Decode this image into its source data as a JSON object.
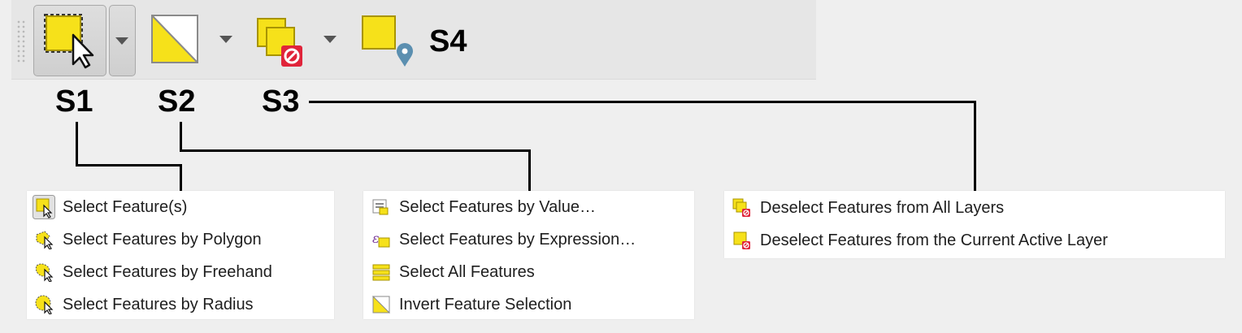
{
  "toolbar": {
    "s4_label": "S4",
    "buttons": [
      {
        "icon": "select-features-icon"
      },
      {
        "icon": "select-features-by-value-icon"
      },
      {
        "icon": "deselect-features-icon"
      },
      {
        "icon": "select-by-location-icon"
      }
    ]
  },
  "labels": {
    "s1": "S1",
    "s2": "S2",
    "s3": "S3"
  },
  "menus": {
    "s1": {
      "items": [
        {
          "label": "Select Feature(s)",
          "icon": "select-feature-icon"
        },
        {
          "label": "Select Features by Polygon",
          "icon": "select-polygon-icon"
        },
        {
          "label": "Select Features by Freehand",
          "icon": "select-freehand-icon"
        },
        {
          "label": "Select Features by Radius",
          "icon": "select-radius-icon"
        }
      ]
    },
    "s2": {
      "items": [
        {
          "label": "Select Features by Value…",
          "icon": "select-by-value-icon"
        },
        {
          "label": "Select Features by Expression…",
          "icon": "select-by-expression-icon"
        },
        {
          "label": "Select All Features",
          "icon": "select-all-icon"
        },
        {
          "label": "Invert Feature Selection",
          "icon": "invert-selection-icon"
        }
      ]
    },
    "s3": {
      "items": [
        {
          "label": "Deselect Features from All Layers",
          "icon": "deselect-all-layers-icon"
        },
        {
          "label": "Deselect Features from the Current Active Layer",
          "icon": "deselect-active-layer-icon"
        }
      ]
    }
  },
  "colors": {
    "feature_yellow": "#f6e11a",
    "deselect_red": "#e0243a",
    "pin_blue": "#5b8fb0"
  }
}
